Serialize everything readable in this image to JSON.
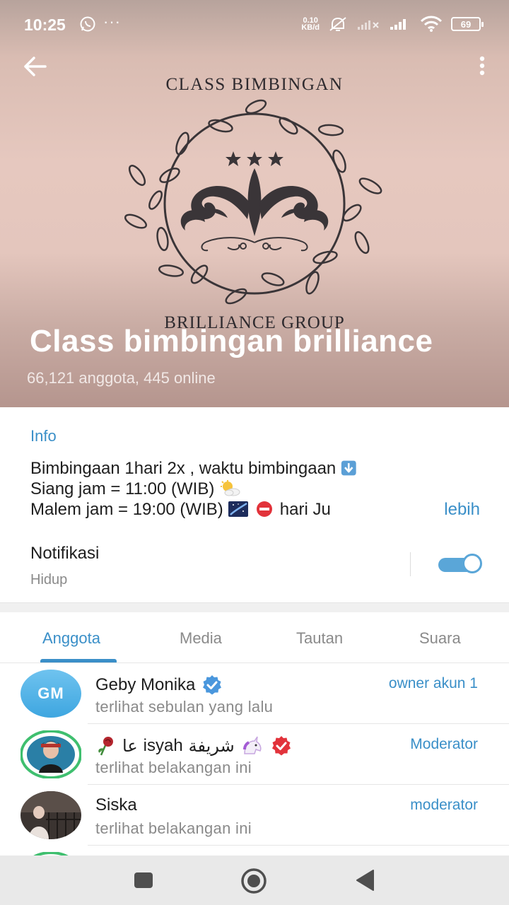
{
  "status_bar": {
    "time": "10:25",
    "more_indicator": "···",
    "net_speed_value": "0.10",
    "net_speed_unit": "KB/d",
    "battery": "69"
  },
  "header": {
    "logo_top_text": "CLASS BIMBINGAN",
    "logo_bottom_text": "BRILLIANCE GROUP",
    "title": "Class bimbingan brilliance",
    "subtitle": "66,121 anggota, 445 online"
  },
  "info": {
    "label": "Info",
    "description_lines": [
      "Bimbingaan 1hari 2x , waktu bimbingaan",
      "Siang jam = 11:00 (WIB)",
      "Malem jam = 19:00 (WIB)",
      "hari Ju"
    ],
    "more_label": "lebih",
    "notification_title": "Notifikasi",
    "notification_status": "Hidup",
    "notification_on": true
  },
  "tabs": [
    {
      "label": "Anggota",
      "active": true
    },
    {
      "label": "Media",
      "active": false
    },
    {
      "label": "Tautan",
      "active": false
    },
    {
      "label": "Suara",
      "active": false
    }
  ],
  "members": [
    {
      "initials": "GM",
      "name": "Geby Monika",
      "status": "terlihat sebulan yang lalu",
      "role": "owner akun 1",
      "badge": "verified-blue-icon"
    },
    {
      "name_ar": "شريفة",
      "name_latin": "isyah",
      "name_ar_prefix": "عا",
      "status": "terlihat belakangan ini",
      "role": "Moderator",
      "badge": "verified-red-icon"
    },
    {
      "name": "Siska",
      "status": "terlihat belakangan ini",
      "role": "moderator"
    }
  ],
  "colors": {
    "accent": "#3a8fc8",
    "toggle": "#5aa6d8",
    "avatar_gm": "#4aaee4"
  }
}
